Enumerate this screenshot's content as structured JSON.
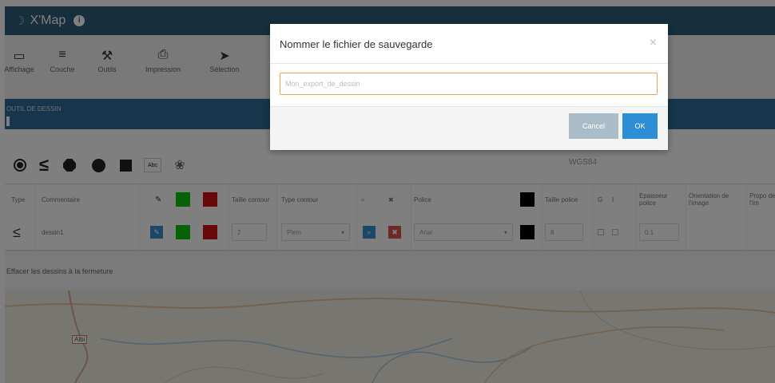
{
  "app": {
    "title": "X'Map",
    "logo_glyph": "☽",
    "info_glyph": "i"
  },
  "toolbar": {
    "items": [
      {
        "label": "Affichage",
        "icon": "monitor-icon",
        "glyph": "▭"
      },
      {
        "label": "Couche",
        "icon": "list-icon",
        "glyph": "≡"
      },
      {
        "label": "Outils",
        "icon": "wrench-icon",
        "glyph": "⚒"
      },
      {
        "label": "Impression",
        "icon": "printer-icon",
        "glyph": "⎙"
      },
      {
        "label": "Sélection",
        "icon": "cursor-icon",
        "glyph": "➤"
      }
    ]
  },
  "section": {
    "label": "OUTIL DE DESSIN"
  },
  "tools": {
    "text_tool": "Abc",
    "image_tool_glyph": "❀",
    "line_glyph": "≤",
    "projection": "WGS84"
  },
  "table": {
    "headers": {
      "type": "Type",
      "comment": "Commentaire",
      "contour_size": "Taille contour",
      "contour_type": "Type contour",
      "font": "Police",
      "font_size": "Taille police",
      "bold": "G",
      "italic": "I",
      "font_thickness": "Epaisseur police",
      "image_orientation": "Orientation de l'image",
      "image_prop": "Propo de l'im"
    },
    "row": {
      "type_glyph": "≤",
      "comment": "dessin1",
      "contour_size": "2",
      "contour_type": "Plein",
      "font": "Arial",
      "font_size": "8",
      "font_thickness": "0.1"
    }
  },
  "footer": {
    "label": "Effacer les dessins à la fermeture"
  },
  "map": {
    "place_label": "Albi"
  },
  "modal": {
    "title": "Nommer le fichier de sauvegarde",
    "close_glyph": "×",
    "input_placeholder": "Mon_export_de_dessin",
    "cancel_label": "Cancel",
    "ok_label": "OK"
  },
  "colors": {
    "titlebar": "#2f5c78",
    "section": "#2e6a96",
    "green": "#0ec40e",
    "red": "#d01212",
    "ok_button": "#2d8ed6",
    "input_focus_border": "#f0a254"
  }
}
